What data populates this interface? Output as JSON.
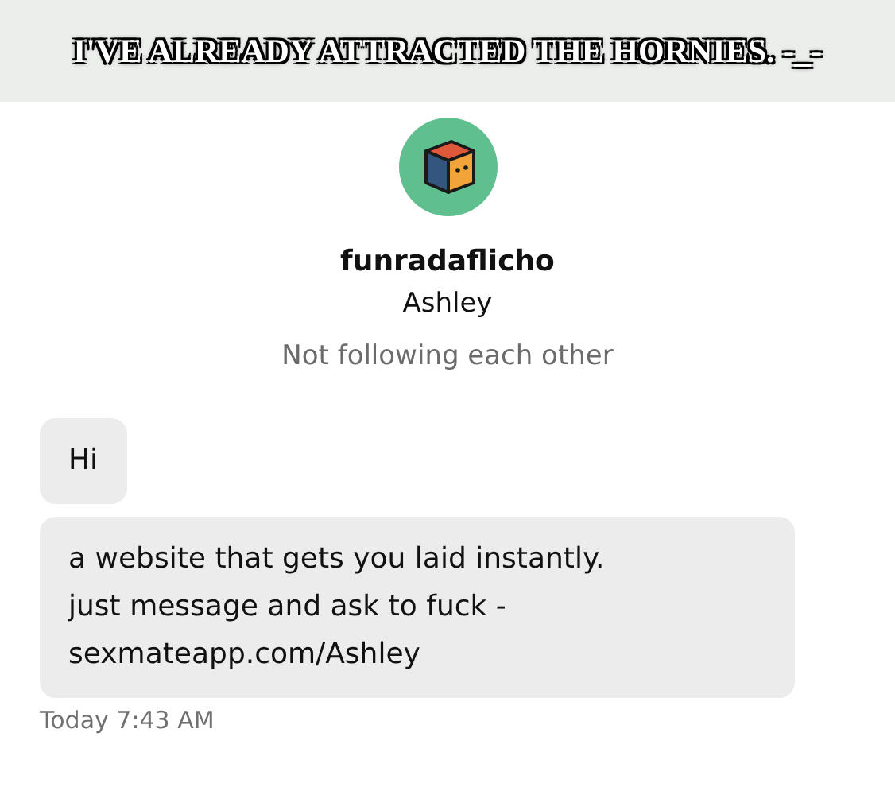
{
  "caption": "I'VE ALREADY ATTRACTED THE HORNIES. -_-",
  "profile": {
    "username": "funradaflicho",
    "display_name": "Ashley",
    "relationship": "Not following each other"
  },
  "messages": [
    {
      "text": "Hi"
    },
    {
      "text": "a website that gets you laid instantly.\njust message and ask to fuck -\nsexmateapp.com/Ashley"
    }
  ],
  "timestamp": "Today 7:43 AM"
}
